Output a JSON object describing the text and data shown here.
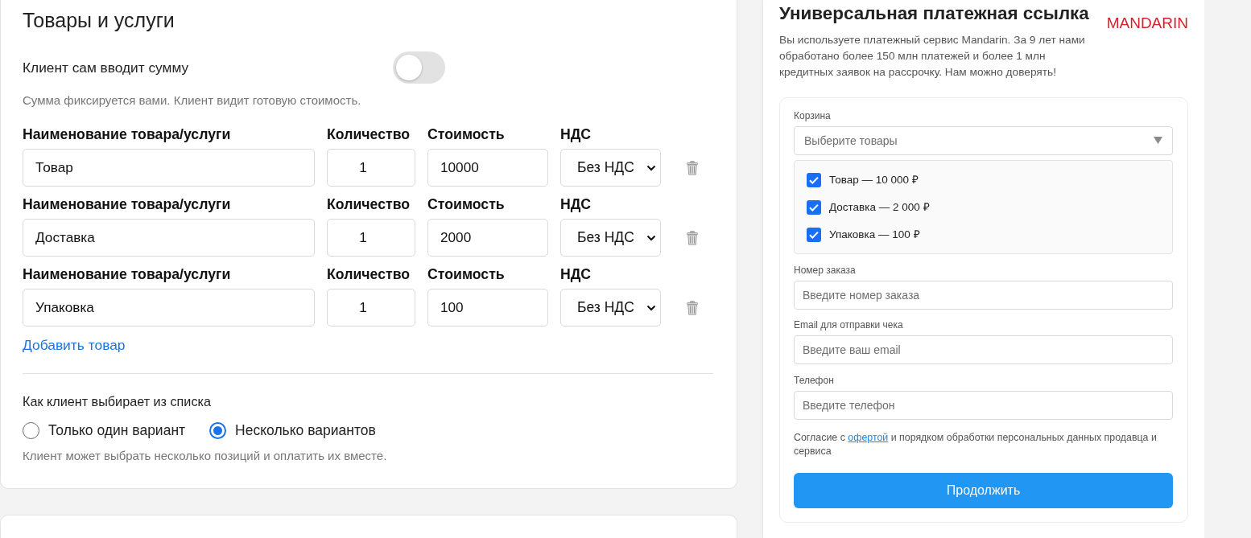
{
  "products": {
    "title": "Товары и услуги",
    "custom_amount": {
      "label": "Клиент сам вводит сумму",
      "on": false
    },
    "fixed_hint": "Сумма фиксируется вами. Клиент видит готовую стоимость.",
    "items": [
      {
        "name_label": "Наименование товара/услуги",
        "name": "Товар",
        "qty_label": "Количество",
        "qty": "1",
        "price_label": "Стоимость",
        "price": "10000",
        "vat_label": "НДС",
        "vat": "Без НДС"
      },
      {
        "name_label": "Наименование товара/услуги",
        "name": "Доставка",
        "qty_label": "Количество",
        "qty": "1",
        "price_label": "Стоимость",
        "price": "2000",
        "vat_label": "НДС",
        "vat": "Без НДС"
      },
      {
        "name_label": "Наименование товара/услуги",
        "name": "Упаковка",
        "qty_label": "Количество",
        "qty": "1",
        "price_label": "Стоимость",
        "price": "100",
        "vat_label": "НДС",
        "vat": "Без НДС"
      }
    ],
    "add_item": "Добавить товар",
    "choice": {
      "label": "Как клиент выбирает из списка",
      "options": [
        {
          "label": "Только один вариант",
          "selected": false
        },
        {
          "label": "Несколько вариантов",
          "selected": true
        }
      ],
      "hint": "Клиент может выбрать несколько позиций и оплатить их вместе."
    }
  },
  "payment_link": {
    "title": "Универсальная платежная ссылка",
    "logo": "MANDARIN",
    "description": "Вы используете платежный сервис Mandarin. За 9 лет нами обработано более 150 млн платежей и более 1 млн кредитных заявок на рассрочку. Нам можно доверять!",
    "cart": {
      "label": "Корзина",
      "placeholder": "Выберите товары",
      "items": [
        {
          "label": "Товар — 10 000 ₽",
          "checked": true
        },
        {
          "label": "Доставка — 2 000 ₽",
          "checked": true
        },
        {
          "label": "Упаковка — 100 ₽",
          "checked": true
        }
      ]
    },
    "fields": [
      {
        "label": "Номер заказа",
        "placeholder": "Введите номер заказа"
      },
      {
        "label": "Email для отправки чека",
        "placeholder": "Введите ваш email"
      },
      {
        "label": "Телефон",
        "placeholder": "Введите телефон"
      }
    ],
    "consent": {
      "before": "Согласие с",
      "link": "офертой",
      "after": "и порядком обработки персональных данных продавца и сервиса"
    },
    "button": "Продолжить"
  }
}
